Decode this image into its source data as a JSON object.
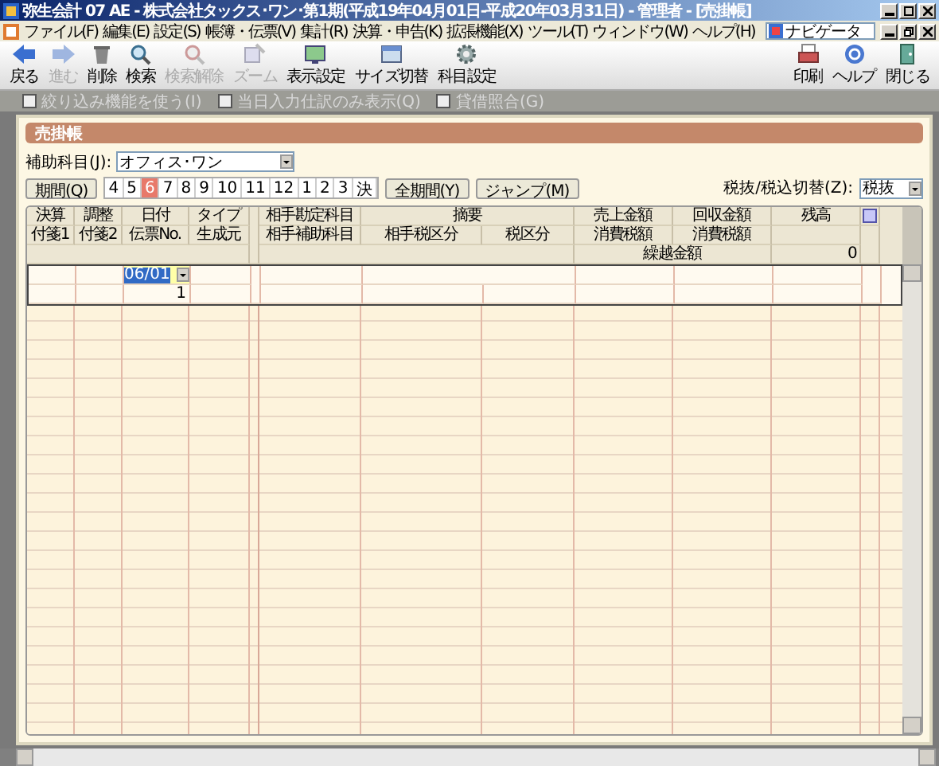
{
  "window": {
    "title": "弥生会計 07 AE - 株式会社タックス･ワン･第1期(平成19年04月01日-平成20年03月31日) - 管理者 - [売掛帳]"
  },
  "menu": [
    "ファイル(F)",
    "編集(E)",
    "設定(S)",
    "帳簿・伝票(V)",
    "集計(R)",
    "決算・申告(K)",
    "拡張機能(X)",
    "ツール(T)",
    "ウィンドウ(W)",
    "ヘルプ(H)"
  ],
  "navigator": "ナビゲータ",
  "toolbar": [
    {
      "kind": "back",
      "label": "戻る",
      "disabled": false
    },
    {
      "kind": "forward",
      "label": "進む",
      "disabled": true
    },
    {
      "kind": "delete",
      "label": "削除",
      "disabled": false
    },
    {
      "kind": "search",
      "label": "検索",
      "disabled": false
    },
    {
      "kind": "clear",
      "label": "検索解除",
      "disabled": true
    },
    {
      "kind": "zoom",
      "label": "ズーム",
      "disabled": true
    },
    {
      "kind": "view",
      "label": "表示設定",
      "disabled": false
    },
    {
      "kind": "size",
      "label": "サイズ切替",
      "disabled": false
    },
    {
      "kind": "account",
      "label": "科目設定",
      "disabled": false
    }
  ],
  "toolbar_right": [
    {
      "kind": "print",
      "label": "印刷",
      "disabled": false
    },
    {
      "kind": "help",
      "label": "ヘルプ",
      "disabled": false
    },
    {
      "kind": "close",
      "label": "閉じる",
      "disabled": false
    }
  ],
  "options": [
    {
      "label": "絞り込み機能を使う(I)",
      "checked": false,
      "disabled": true
    },
    {
      "label": "当日入力仕訳のみ表示(Q)",
      "checked": false,
      "disabled": true
    },
    {
      "label": "貸借照合(G)",
      "checked": false,
      "disabled": true
    }
  ],
  "panel_title": "売掛帳",
  "sub_account": {
    "label": "補助科目(J):",
    "value": "オフィス･ワン"
  },
  "period_button": "期間(Q)",
  "months": [
    {
      "label": "4",
      "selected": false
    },
    {
      "label": "5",
      "selected": false
    },
    {
      "label": "6",
      "selected": true
    },
    {
      "label": "7",
      "selected": false
    },
    {
      "label": "8",
      "selected": false
    },
    {
      "label": "9",
      "selected": false
    },
    {
      "label": "10",
      "selected": false
    },
    {
      "label": "11",
      "selected": false
    },
    {
      "label": "12",
      "selected": false
    },
    {
      "label": "1",
      "selected": false
    },
    {
      "label": "2",
      "selected": false
    },
    {
      "label": "3",
      "selected": false
    },
    {
      "label": "決",
      "selected": false
    }
  ],
  "all_period_button": "全期間(Y)",
  "jump_button": "ジャンプ(M)",
  "tax_mode": {
    "label": "税抜/税込切替(Z):",
    "value": "税抜"
  },
  "table": {
    "headers": {
      "settle": "決算",
      "tag1": "付箋1",
      "adjust": "調整",
      "tag2": "付箋2",
      "date": "日付",
      "slip_no": "伝票No.",
      "type": "タイプ",
      "source": "生成元",
      "counter_account": "相手勘定科目",
      "counter_sub": "相手補助科目",
      "summary": "摘要",
      "counter_tax": "相手税区分",
      "tax": "税区分",
      "sales": "売上金額",
      "sales_tax": "消費税額",
      "collected": "回収金額",
      "collected_tax": "消費税額",
      "balance": "残高"
    },
    "carryover": {
      "label": "繰越金額",
      "value": "0"
    },
    "rows": [
      {
        "date": "06/01",
        "slip_no": "1"
      }
    ]
  }
}
